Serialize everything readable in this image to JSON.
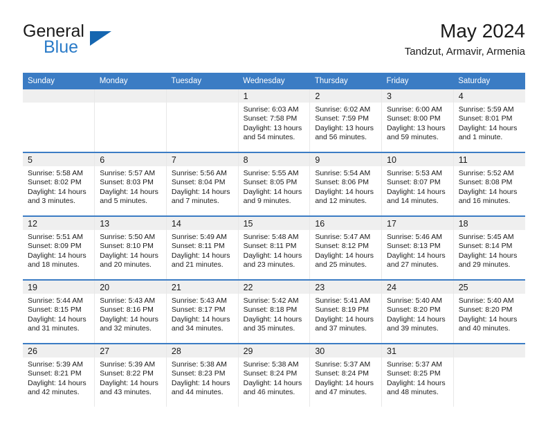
{
  "brand": {
    "name_part1": "General",
    "name_part2": "Blue",
    "triangle_color": "#1566b0",
    "blue_color": "#2a7bc8"
  },
  "header": {
    "title": "May 2024",
    "subtitle": "Tandzut, Armavir, Armenia"
  },
  "theme": {
    "header_bg": "#3b7cc4",
    "header_text": "#ffffff",
    "daynum_bg": "#efefef",
    "cell_bg": "#ffffff",
    "row_divider": "#3b7cc4"
  },
  "weekday_headers": [
    "Sunday",
    "Monday",
    "Tuesday",
    "Wednesday",
    "Thursday",
    "Friday",
    "Saturday"
  ],
  "weeks": [
    [
      {
        "day": "",
        "lines": []
      },
      {
        "day": "",
        "lines": []
      },
      {
        "day": "",
        "lines": []
      },
      {
        "day": "1",
        "lines": [
          "Sunrise: 6:03 AM",
          "Sunset: 7:58 PM",
          "Daylight: 13 hours",
          "and 54 minutes."
        ]
      },
      {
        "day": "2",
        "lines": [
          "Sunrise: 6:02 AM",
          "Sunset: 7:59 PM",
          "Daylight: 13 hours",
          "and 56 minutes."
        ]
      },
      {
        "day": "3",
        "lines": [
          "Sunrise: 6:00 AM",
          "Sunset: 8:00 PM",
          "Daylight: 13 hours",
          "and 59 minutes."
        ]
      },
      {
        "day": "4",
        "lines": [
          "Sunrise: 5:59 AM",
          "Sunset: 8:01 PM",
          "Daylight: 14 hours",
          "and 1 minute."
        ]
      }
    ],
    [
      {
        "day": "5",
        "lines": [
          "Sunrise: 5:58 AM",
          "Sunset: 8:02 PM",
          "Daylight: 14 hours",
          "and 3 minutes."
        ]
      },
      {
        "day": "6",
        "lines": [
          "Sunrise: 5:57 AM",
          "Sunset: 8:03 PM",
          "Daylight: 14 hours",
          "and 5 minutes."
        ]
      },
      {
        "day": "7",
        "lines": [
          "Sunrise: 5:56 AM",
          "Sunset: 8:04 PM",
          "Daylight: 14 hours",
          "and 7 minutes."
        ]
      },
      {
        "day": "8",
        "lines": [
          "Sunrise: 5:55 AM",
          "Sunset: 8:05 PM",
          "Daylight: 14 hours",
          "and 9 minutes."
        ]
      },
      {
        "day": "9",
        "lines": [
          "Sunrise: 5:54 AM",
          "Sunset: 8:06 PM",
          "Daylight: 14 hours",
          "and 12 minutes."
        ]
      },
      {
        "day": "10",
        "lines": [
          "Sunrise: 5:53 AM",
          "Sunset: 8:07 PM",
          "Daylight: 14 hours",
          "and 14 minutes."
        ]
      },
      {
        "day": "11",
        "lines": [
          "Sunrise: 5:52 AM",
          "Sunset: 8:08 PM",
          "Daylight: 14 hours",
          "and 16 minutes."
        ]
      }
    ],
    [
      {
        "day": "12",
        "lines": [
          "Sunrise: 5:51 AM",
          "Sunset: 8:09 PM",
          "Daylight: 14 hours",
          "and 18 minutes."
        ]
      },
      {
        "day": "13",
        "lines": [
          "Sunrise: 5:50 AM",
          "Sunset: 8:10 PM",
          "Daylight: 14 hours",
          "and 20 minutes."
        ]
      },
      {
        "day": "14",
        "lines": [
          "Sunrise: 5:49 AM",
          "Sunset: 8:11 PM",
          "Daylight: 14 hours",
          "and 21 minutes."
        ]
      },
      {
        "day": "15",
        "lines": [
          "Sunrise: 5:48 AM",
          "Sunset: 8:11 PM",
          "Daylight: 14 hours",
          "and 23 minutes."
        ]
      },
      {
        "day": "16",
        "lines": [
          "Sunrise: 5:47 AM",
          "Sunset: 8:12 PM",
          "Daylight: 14 hours",
          "and 25 minutes."
        ]
      },
      {
        "day": "17",
        "lines": [
          "Sunrise: 5:46 AM",
          "Sunset: 8:13 PM",
          "Daylight: 14 hours",
          "and 27 minutes."
        ]
      },
      {
        "day": "18",
        "lines": [
          "Sunrise: 5:45 AM",
          "Sunset: 8:14 PM",
          "Daylight: 14 hours",
          "and 29 minutes."
        ]
      }
    ],
    [
      {
        "day": "19",
        "lines": [
          "Sunrise: 5:44 AM",
          "Sunset: 8:15 PM",
          "Daylight: 14 hours",
          "and 31 minutes."
        ]
      },
      {
        "day": "20",
        "lines": [
          "Sunrise: 5:43 AM",
          "Sunset: 8:16 PM",
          "Daylight: 14 hours",
          "and 32 minutes."
        ]
      },
      {
        "day": "21",
        "lines": [
          "Sunrise: 5:43 AM",
          "Sunset: 8:17 PM",
          "Daylight: 14 hours",
          "and 34 minutes."
        ]
      },
      {
        "day": "22",
        "lines": [
          "Sunrise: 5:42 AM",
          "Sunset: 8:18 PM",
          "Daylight: 14 hours",
          "and 35 minutes."
        ]
      },
      {
        "day": "23",
        "lines": [
          "Sunrise: 5:41 AM",
          "Sunset: 8:19 PM",
          "Daylight: 14 hours",
          "and 37 minutes."
        ]
      },
      {
        "day": "24",
        "lines": [
          "Sunrise: 5:40 AM",
          "Sunset: 8:20 PM",
          "Daylight: 14 hours",
          "and 39 minutes."
        ]
      },
      {
        "day": "25",
        "lines": [
          "Sunrise: 5:40 AM",
          "Sunset: 8:20 PM",
          "Daylight: 14 hours",
          "and 40 minutes."
        ]
      }
    ],
    [
      {
        "day": "26",
        "lines": [
          "Sunrise: 5:39 AM",
          "Sunset: 8:21 PM",
          "Daylight: 14 hours",
          "and 42 minutes."
        ]
      },
      {
        "day": "27",
        "lines": [
          "Sunrise: 5:39 AM",
          "Sunset: 8:22 PM",
          "Daylight: 14 hours",
          "and 43 minutes."
        ]
      },
      {
        "day": "28",
        "lines": [
          "Sunrise: 5:38 AM",
          "Sunset: 8:23 PM",
          "Daylight: 14 hours",
          "and 44 minutes."
        ]
      },
      {
        "day": "29",
        "lines": [
          "Sunrise: 5:38 AM",
          "Sunset: 8:24 PM",
          "Daylight: 14 hours",
          "and 46 minutes."
        ]
      },
      {
        "day": "30",
        "lines": [
          "Sunrise: 5:37 AM",
          "Sunset: 8:24 PM",
          "Daylight: 14 hours",
          "and 47 minutes."
        ]
      },
      {
        "day": "31",
        "lines": [
          "Sunrise: 5:37 AM",
          "Sunset: 8:25 PM",
          "Daylight: 14 hours",
          "and 48 minutes."
        ]
      },
      {
        "day": "",
        "lines": []
      }
    ]
  ]
}
